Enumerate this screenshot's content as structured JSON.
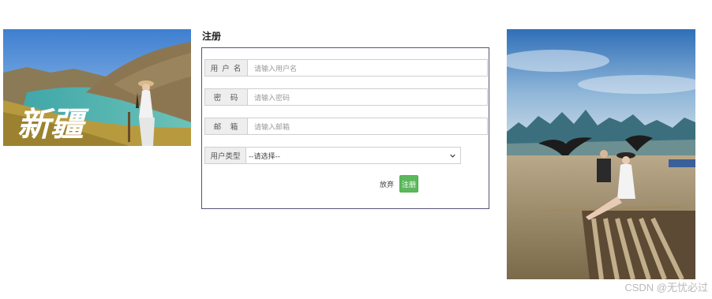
{
  "left_banner": {
    "calligraphy": "新疆",
    "alt": "left-landscape-photo"
  },
  "form": {
    "title": "注册",
    "username": {
      "label": "用 户 名",
      "placeholder": "请输入用户名"
    },
    "password": {
      "label": "密　码",
      "placeholder": "请输入密码"
    },
    "email": {
      "label": "邮　箱",
      "placeholder": "请输入邮箱"
    },
    "user_type": {
      "label": "用户类型",
      "selected": "--请选择--"
    },
    "cancel_label": "放弃",
    "submit_label": "注册",
    "colors": {
      "panel_border": "#5a5377",
      "submit_bg": "#5cb85c"
    }
  },
  "watermark": "CSDN @无忧必过"
}
